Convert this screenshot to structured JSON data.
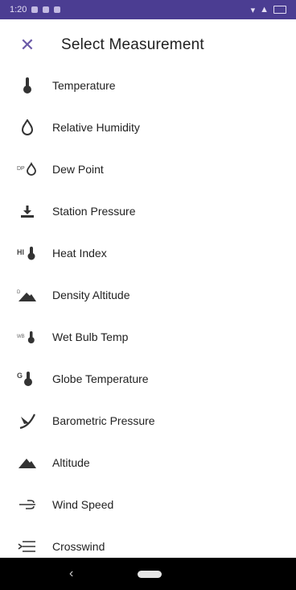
{
  "status_bar": {
    "time": "1:20"
  },
  "app_bar": {
    "title": "Select Measurement",
    "close_icon": "close-icon"
  },
  "colors": {
    "accent": "#6b5aa8",
    "status_bar": "#4b3d92",
    "text": "#222222",
    "icon": "#333333"
  },
  "items": [
    {
      "label": "Temperature",
      "icon": "thermometer-icon"
    },
    {
      "label": "Relative Humidity",
      "icon": "droplet-icon"
    },
    {
      "label": "Dew Point",
      "icon": "dew-point-icon"
    },
    {
      "label": "Station Pressure",
      "icon": "pressure-arrow-icon"
    },
    {
      "label": "Heat Index",
      "icon": "heat-index-icon"
    },
    {
      "label": "Density Altitude",
      "icon": "density-altitude-icon"
    },
    {
      "label": "Wet Bulb Temp",
      "icon": "wet-bulb-icon"
    },
    {
      "label": "Globe Temperature",
      "icon": "globe-temp-icon"
    },
    {
      "label": "Barometric Pressure",
      "icon": "barometer-icon"
    },
    {
      "label": "Altitude",
      "icon": "mountain-icon"
    },
    {
      "label": "Wind Speed",
      "icon": "wind-icon"
    },
    {
      "label": "Crosswind",
      "icon": "crosswind-icon"
    }
  ]
}
